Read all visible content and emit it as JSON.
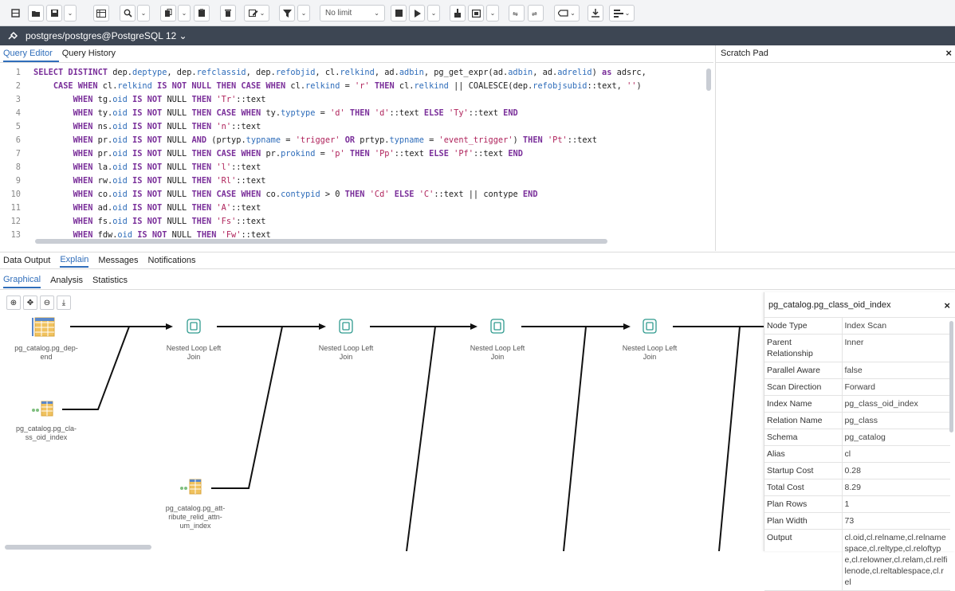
{
  "toolbar": {
    "row_limit": "No limit",
    "icons": [
      "open-file-icon",
      "save-icon",
      "save-dropdown-icon",
      "table-icon",
      "find-icon",
      "find-dropdown-icon",
      "copy-icon",
      "copy-dropdown-icon",
      "paste-icon",
      "delete-icon",
      "edit-icon",
      "filter-icon",
      "filter-dropdown-icon",
      "row-limit-select",
      "stop-icon",
      "execute-icon",
      "execute-dropdown-icon",
      "commit-icon",
      "explain-icon",
      "explain-dropdown-icon",
      "rollback-icon",
      "commit-transaction-icon",
      "clear-icon",
      "download-icon",
      "macros-icon"
    ]
  },
  "connection": {
    "label": "postgres/postgres@PostgreSQL 12 ⌄"
  },
  "editor_tabs": [
    "Query Editor",
    "Query History"
  ],
  "scratch_pad": {
    "title": "Scratch Pad",
    "close": "×"
  },
  "code_lines": [
    {
      "no": "1",
      "html": "<span class='kw'>SELECT DISTINCT</span> dep.<span class='fn'>deptype</span>, dep.<span class='fn'>refclassid</span>, dep.<span class='fn'>refobjid</span>, cl.<span class='fn'>relkind</span>, ad.<span class='fn'>adbin</span>, pg_get_expr(ad.<span class='fn'>adbin</span>, ad.<span class='fn'>adrelid</span>) <span class='kw'>as</span> adsrc,"
    },
    {
      "no": "2",
      "html": "    <span class='kw'>CASE WHEN</span> cl.<span class='fn'>relkind</span> <span class='kw'>IS NOT NULL THEN CASE WHEN</span> cl.<span class='fn'>relkind</span> = <span class='st'>'r'</span> <span class='kw'>THEN</span> cl.<span class='fn'>relkind</span> || COALESCE(dep.<span class='fn'>refobjsubid</span>::text, <span class='st'>''</span>)"
    },
    {
      "no": "3",
      "html": "        <span class='kw'>WHEN</span> tg.<span class='fn'>oid</span> <span class='kw'>IS NOT</span> NULL <span class='kw'>THEN</span> <span class='st'>'Tr'</span>::text"
    },
    {
      "no": "4",
      "html": "        <span class='kw'>WHEN</span> ty.<span class='fn'>oid</span> <span class='kw'>IS NOT</span> NULL <span class='kw'>THEN CASE WHEN</span> ty.<span class='fn'>typtype</span> = <span class='st'>'d'</span> <span class='kw'>THEN</span> <span class='st'>'d'</span>::text <span class='kw'>ELSE</span> <span class='st'>'Ty'</span>::text <span class='kw'>END</span>"
    },
    {
      "no": "5",
      "html": "        <span class='kw'>WHEN</span> ns.<span class='fn'>oid</span> <span class='kw'>IS NOT</span> NULL <span class='kw'>THEN</span> <span class='st'>'n'</span>::text"
    },
    {
      "no": "6",
      "html": "        <span class='kw'>WHEN</span> pr.<span class='fn'>oid</span> <span class='kw'>IS NOT</span> NULL <span class='kw'>AND</span> (prtyp.<span class='fn'>typname</span> = <span class='st'>'trigger'</span> <span class='kw'>OR</span> prtyp.<span class='fn'>typname</span> = <span class='st'>'event_trigger'</span>) <span class='kw'>THEN</span> <span class='st'>'Pt'</span>::text"
    },
    {
      "no": "7",
      "html": "        <span class='kw'>WHEN</span> pr.<span class='fn'>oid</span> <span class='kw'>IS NOT</span> NULL <span class='kw'>THEN CASE WHEN</span> pr.<span class='fn'>prokind</span> = <span class='st'>'p'</span> <span class='kw'>THEN</span> <span class='st'>'Pp'</span>::text <span class='kw'>ELSE</span> <span class='st'>'Pf'</span>::text <span class='kw'>END</span>"
    },
    {
      "no": "8",
      "html": "        <span class='kw'>WHEN</span> la.<span class='fn'>oid</span> <span class='kw'>IS NOT</span> NULL <span class='kw'>THEN</span> <span class='st'>'l'</span>::text"
    },
    {
      "no": "9",
      "html": "        <span class='kw'>WHEN</span> rw.<span class='fn'>oid</span> <span class='kw'>IS NOT</span> NULL <span class='kw'>THEN</span> <span class='st'>'Rl'</span>::text"
    },
    {
      "no": "10",
      "html": "        <span class='kw'>WHEN</span> co.<span class='fn'>oid</span> <span class='kw'>IS NOT</span> NULL <span class='kw'>THEN CASE WHEN</span> co.<span class='fn'>contypid</span> &gt; 0 <span class='kw'>THEN</span> <span class='st'>'Cd'</span> <span class='kw'>ELSE</span> <span class='st'>'C'</span>::text || contype <span class='kw'>END</span>"
    },
    {
      "no": "11",
      "html": "        <span class='kw'>WHEN</span> ad.<span class='fn'>oid</span> <span class='kw'>IS NOT</span> NULL <span class='kw'>THEN</span> <span class='st'>'A'</span>::text"
    },
    {
      "no": "12",
      "html": "        <span class='kw'>WHEN</span> fs.<span class='fn'>oid</span> <span class='kw'>IS NOT</span> NULL <span class='kw'>THEN</span> <span class='st'>'Fs'</span>::text"
    },
    {
      "no": "13",
      "html": "        <span class='kw'>WHEN</span> fdw.<span class='fn'>oid</span> <span class='kw'>IS NOT</span> NULL <span class='kw'>THEN</span> <span class='st'>'Fw'</span>::text"
    }
  ],
  "output_tabs": [
    "Data Output",
    "Explain",
    "Messages",
    "Notifications"
  ],
  "explain_tabs": [
    "Graphical",
    "Analysis",
    "Statistics"
  ],
  "plan": {
    "scan_nodes": [
      {
        "label": "pg_catalog.pg_dep-\nend"
      },
      {
        "label": "pg_catalog.pg_cla-\nss_oid_index"
      },
      {
        "label": "pg_catalog.pg_att-\nribute_relid_attn-\num_index"
      }
    ],
    "join_nodes": [
      {
        "label": "Nested Loop Left\nJoin"
      },
      {
        "label": "Nested Loop Left\nJoin"
      },
      {
        "label": "Nested Loop Left\nJoin"
      },
      {
        "label": "Nested Loop Left\nJoin"
      }
    ]
  },
  "details": {
    "title": "pg_catalog.pg_class_oid_index",
    "close": "×",
    "rows": [
      {
        "k": "Node Type",
        "v": "Index Scan"
      },
      {
        "k": "Parent Relationship",
        "v": "Inner"
      },
      {
        "k": "Parallel Aware",
        "v": "false"
      },
      {
        "k": "Scan Direction",
        "v": "Forward"
      },
      {
        "k": "Index Name",
        "v": "pg_class_oid_index"
      },
      {
        "k": "Relation Name",
        "v": "pg_class"
      },
      {
        "k": "Schema",
        "v": "pg_catalog"
      },
      {
        "k": "Alias",
        "v": "cl"
      },
      {
        "k": "Startup Cost",
        "v": "0.28"
      },
      {
        "k": "Total Cost",
        "v": "8.29"
      },
      {
        "k": "Plan Rows",
        "v": "1"
      },
      {
        "k": "Plan Width",
        "v": "73"
      },
      {
        "k": "Output",
        "v": "cl.oid,cl.relname,cl.relnamespace,cl.reltype,cl.reloftype,cl.relowner,cl.relam,cl.relfilenode,cl.reltablespace,cl.rel"
      }
    ]
  }
}
